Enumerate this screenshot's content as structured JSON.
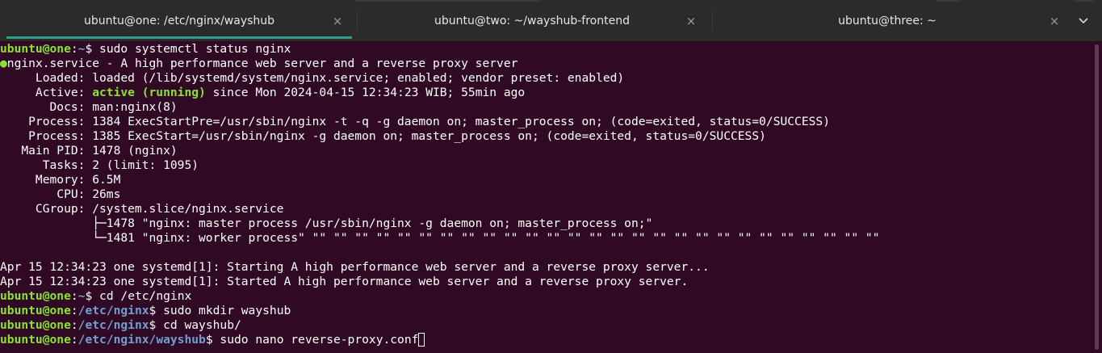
{
  "tabs": [
    {
      "title": "ubuntu@one: /etc/nginx/wayshub",
      "active": true
    },
    {
      "title": "ubuntu@two: ~/wayshub-frontend",
      "active": false
    },
    {
      "title": "ubuntu@three: ~",
      "active": false
    }
  ],
  "icons": {
    "close": "×",
    "tabs_menu": "chevron-down-icon"
  },
  "colors": {
    "background": "#300a24",
    "user_host": "#8ae234",
    "path": "#729fcf",
    "active": "#8ae234",
    "tab_indicator": "#2f9c86"
  },
  "terminal": {
    "user": "ubuntu@one",
    "prompt1": {
      "path": "~",
      "suffix": "$ ",
      "cmd": "sudo systemctl status nginx"
    },
    "status": {
      "dot": "●",
      "header": "nginx.service - A high performance web server and a reverse proxy server",
      "loaded": "     Loaded: loaded (/lib/systemd/system/nginx.service; enabled; vendor preset: enabled)",
      "active_label": "     Active: ",
      "active_state": "active (running)",
      "active_rest": " since Mon 2024-04-15 12:34:23 WIB; 55min ago",
      "docs": "       Docs: man:nginx(8)",
      "process1": "    Process: 1384 ExecStartPre=/usr/sbin/nginx -t -q -g daemon on; master_process on; (code=exited, status=0/SUCCESS)",
      "process2": "    Process: 1385 ExecStart=/usr/sbin/nginx -g daemon on; master_process on; (code=exited, status=0/SUCCESS)",
      "mainpid": "   Main PID: 1478 (nginx)",
      "tasks": "      Tasks: 2 (limit: 1095)",
      "memory": "     Memory: 6.5M",
      "cpu": "        CPU: 26ms",
      "cgroup": "     CGroup: /system.slice/nginx.service",
      "cg1": "             ├─1478 \"nginx: master process /usr/sbin/nginx -g daemon on; master_process on;\"",
      "cg2": "             └─1481 \"nginx: worker process\" \"\" \"\" \"\" \"\" \"\" \"\" \"\" \"\" \"\" \"\" \"\" \"\" \"\" \"\" \"\" \"\" \"\" \"\" \"\" \"\" \"\" \"\" \"\" \"\" \"\" \"\" \"\""
    },
    "log1": "Apr 15 12:34:23 one systemd[1]: Starting A high performance web server and a reverse proxy server...",
    "log2": "Apr 15 12:34:23 one systemd[1]: Started A high performance web server and a reverse proxy server.",
    "prompt2": {
      "path": "~",
      "suffix": "$ ",
      "cmd": "cd /etc/nginx"
    },
    "prompt3": {
      "path": "/etc/nginx",
      "suffix": "$ ",
      "cmd": "sudo mkdir wayshub"
    },
    "prompt4": {
      "path": "/etc/nginx",
      "suffix": "$ ",
      "cmd": "cd wayshub/"
    },
    "prompt5": {
      "path": "/etc/nginx/wayshub",
      "suffix": "$ ",
      "cmd": "sudo nano reverse-proxy.conf"
    }
  }
}
